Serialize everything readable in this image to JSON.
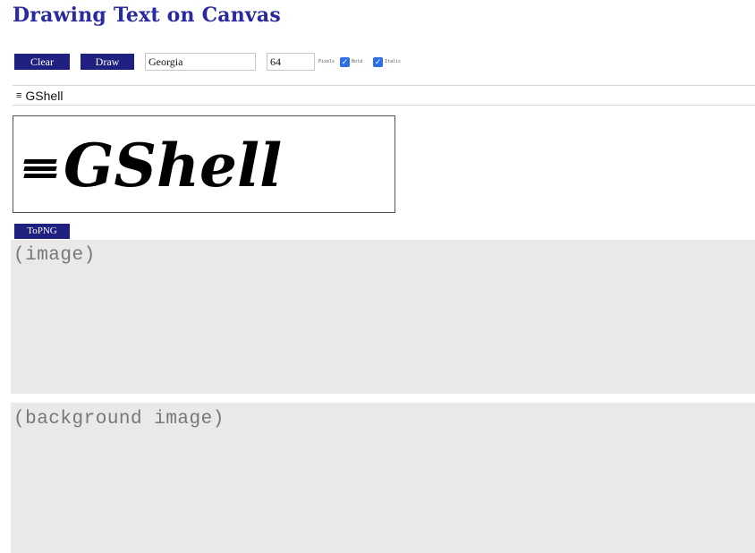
{
  "title": "Drawing Text on Canvas",
  "toolbar": {
    "clear_label": "Clear",
    "draw_label": "Draw",
    "font_value": "Georgia",
    "size_value": "64",
    "pixels_label": "Pixels",
    "bold_label": "Bold",
    "italic_label": "Italic",
    "bold_checked": true,
    "italic_checked": true
  },
  "text_input": {
    "glyph": "≡",
    "value": "GShell"
  },
  "canvas": {
    "text": "GShell"
  },
  "topng_label": "ToPNG",
  "image_panel_label": "(image)",
  "background_panel_label": "(background image)",
  "colors": {
    "title": "#2a2aa0",
    "button": "#1f2080",
    "checkbox": "#2f6fe6",
    "panel": "#e9e9e9"
  }
}
